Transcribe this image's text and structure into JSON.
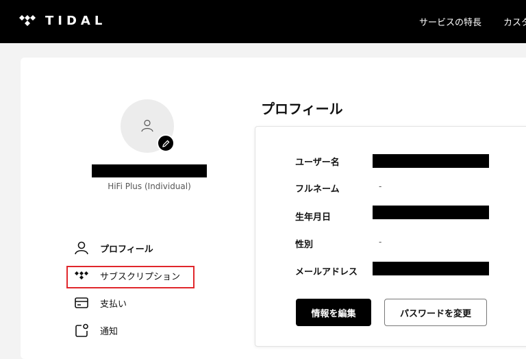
{
  "header": {
    "brand": "TIDAL",
    "nav": [
      "サービスの特長",
      "カスタ"
    ]
  },
  "profile_card": {
    "plan": "HiFi Plus (Individual)"
  },
  "menu": [
    {
      "label": "プロフィール",
      "icon": "user-icon"
    },
    {
      "label": "サブスクリプション",
      "icon": "tidal-logo-icon"
    },
    {
      "label": "支払い",
      "icon": "credit-card-icon"
    },
    {
      "label": "通知",
      "icon": "notification-icon"
    }
  ],
  "main": {
    "title": "プロフィール",
    "fields": [
      {
        "label": "ユーザー名",
        "value": ""
      },
      {
        "label": "フルネーム",
        "value": "-"
      },
      {
        "label": "生年月日",
        "value": ""
      },
      {
        "label": "性別",
        "value": "-"
      },
      {
        "label": "メールアドレス",
        "value": ""
      }
    ],
    "buttons": {
      "edit": "情報を編集",
      "change_password": "パスワードを変更"
    }
  },
  "colors": {
    "topbar": "#000000",
    "highlight": "#e0262b",
    "background": "#f3f3f3"
  }
}
